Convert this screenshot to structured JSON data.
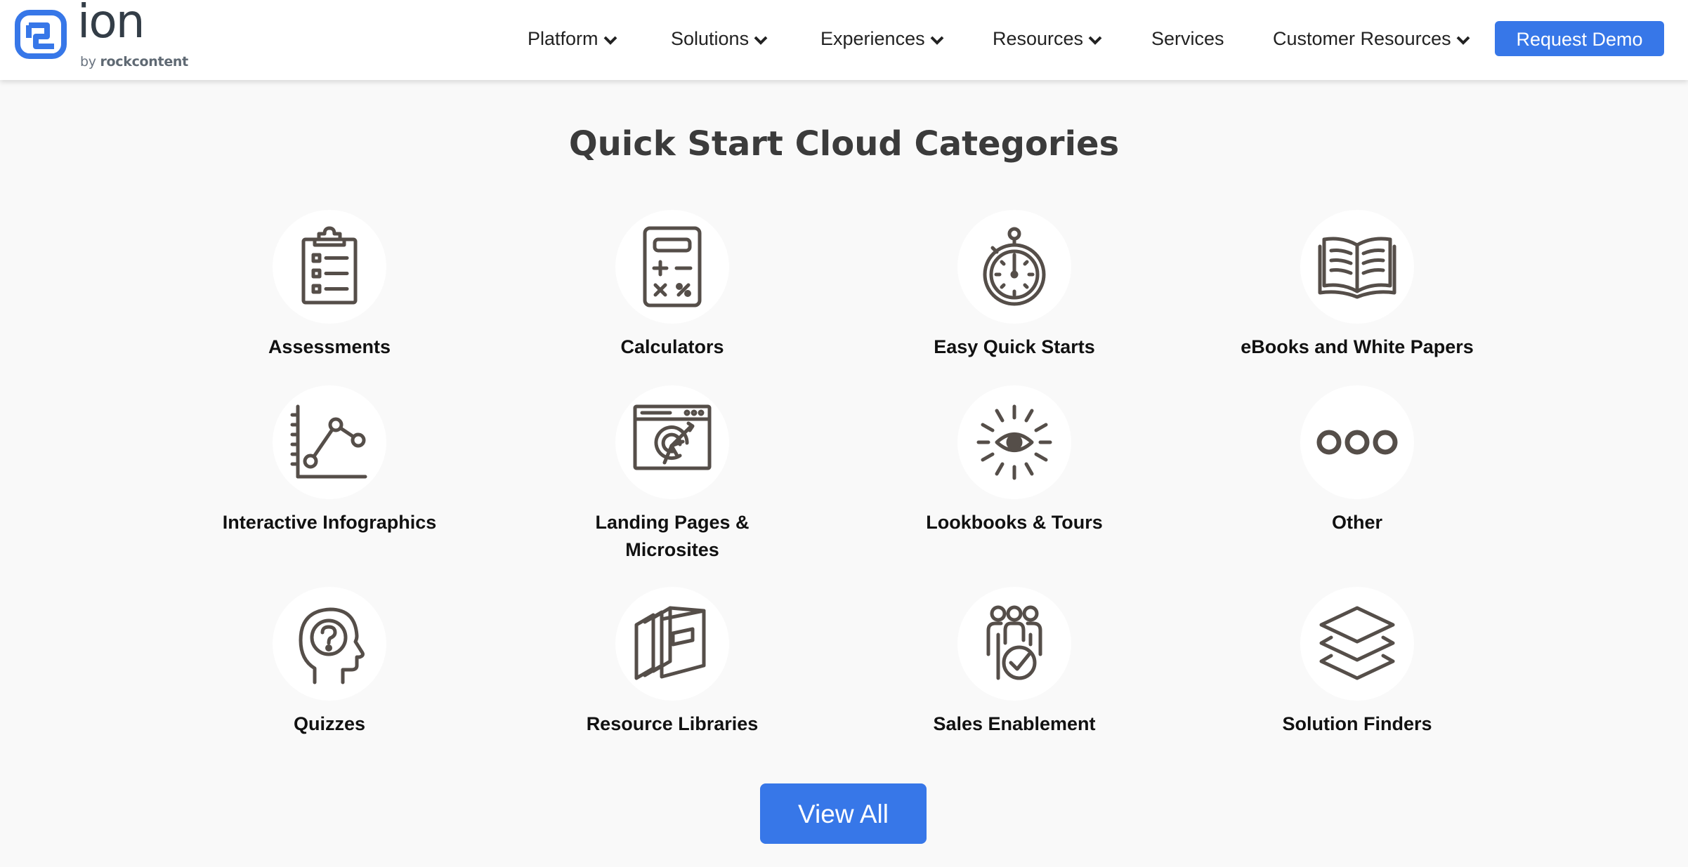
{
  "brand": {
    "name": "ion",
    "by": "by",
    "by_brand": "rockcontent",
    "logo_color": "#3777e8"
  },
  "nav": {
    "items": [
      {
        "label": "Platform",
        "has_dropdown": true
      },
      {
        "label": "Solutions",
        "has_dropdown": true
      },
      {
        "label": "Experiences",
        "has_dropdown": true
      },
      {
        "label": "Resources",
        "has_dropdown": true
      },
      {
        "label": "Services",
        "has_dropdown": false
      },
      {
        "label": "Customer Resources",
        "has_dropdown": true
      }
    ],
    "cta_label": "Request Demo"
  },
  "section": {
    "title": "Quick Start Cloud Categories"
  },
  "categories": [
    {
      "label": "Assessments",
      "icon": "clipboard-icon"
    },
    {
      "label": "Calculators",
      "icon": "calculator-icon"
    },
    {
      "label": "Easy Quick Starts",
      "icon": "stopwatch-icon"
    },
    {
      "label": "eBooks and White Papers",
      "icon": "open-book-icon"
    },
    {
      "label": "Interactive Infographics",
      "icon": "line-chart-icon"
    },
    {
      "label": "Landing Pages & Microsites",
      "icon": "browser-target-icon"
    },
    {
      "label": "Lookbooks & Tours",
      "icon": "eye-icon"
    },
    {
      "label": "Other",
      "icon": "three-circles-icon"
    },
    {
      "label": "Quizzes",
      "icon": "head-question-icon"
    },
    {
      "label": "Resource Libraries",
      "icon": "books-icon"
    },
    {
      "label": "Sales Enablement",
      "icon": "team-check-icon"
    },
    {
      "label": "Solution Finders",
      "icon": "layers-icon"
    }
  ],
  "view_all_label": "View All",
  "colors": {
    "accent": "#3777e8",
    "icon_stroke": "#554e49",
    "background": "#f9f9f9"
  }
}
